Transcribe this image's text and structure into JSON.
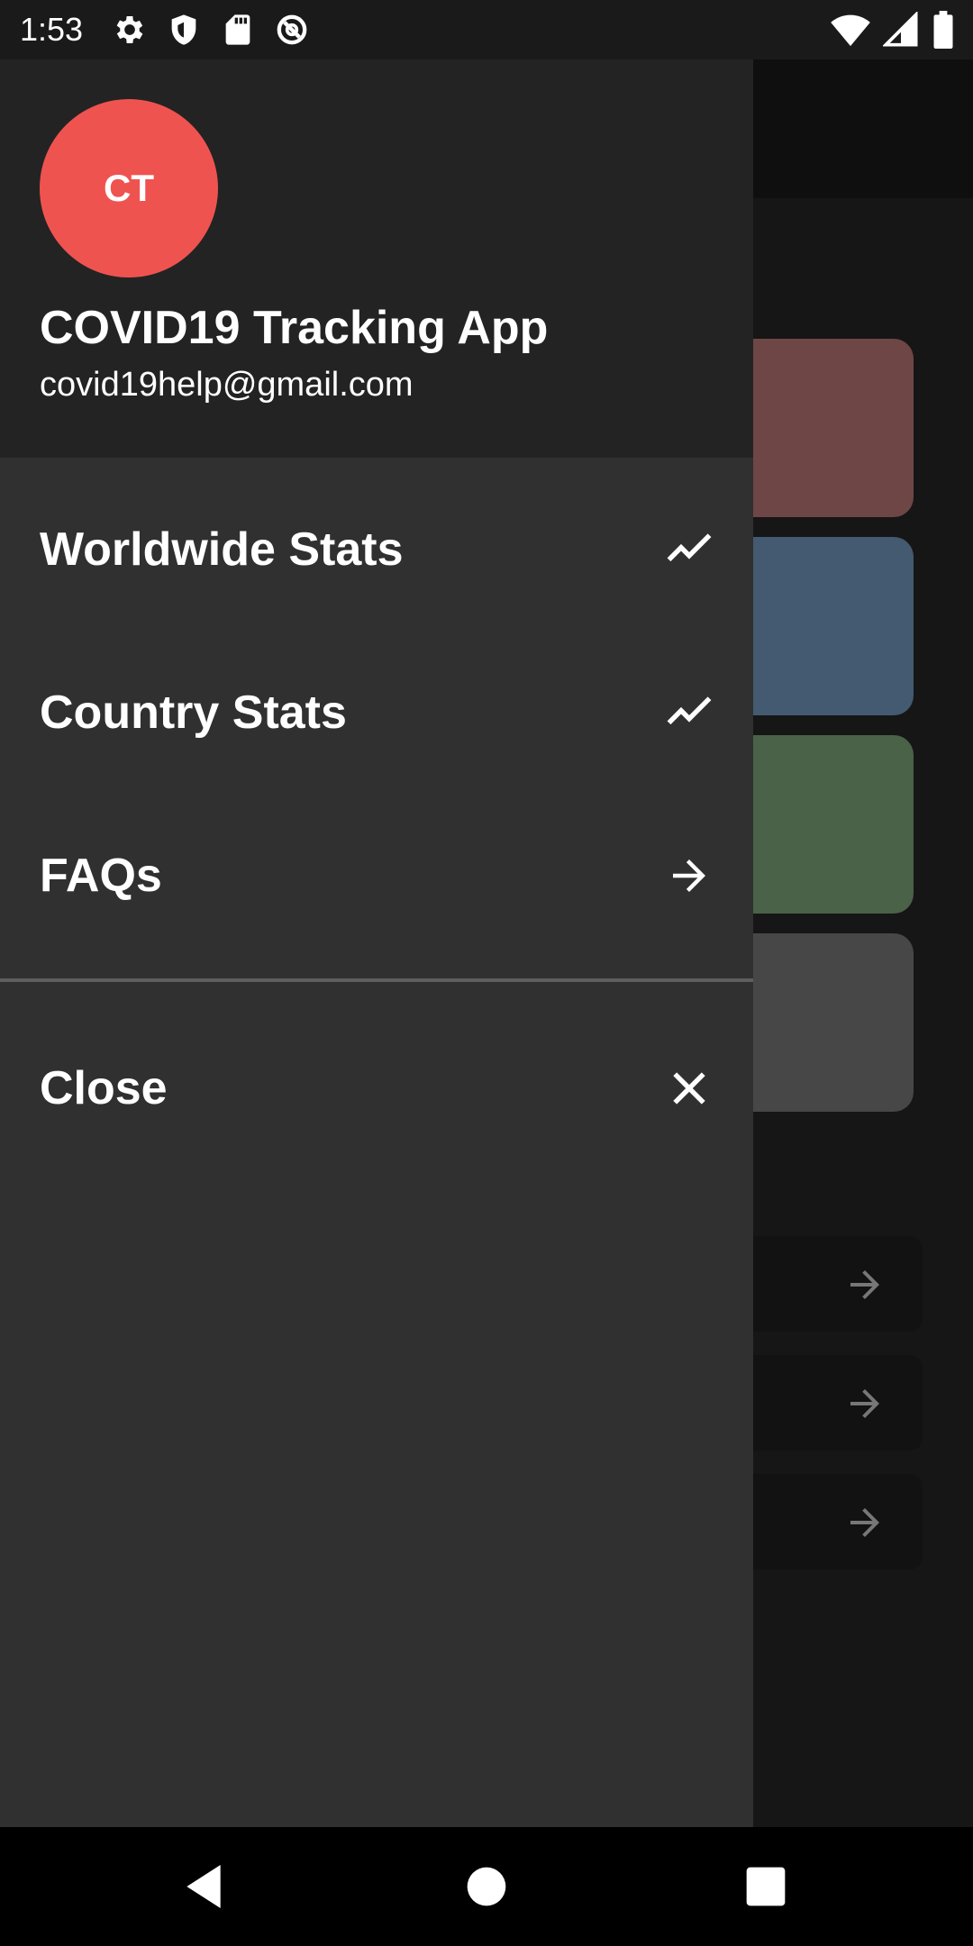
{
  "status_bar": {
    "time": "1:53",
    "left_icons": [
      "settings-gear-icon",
      "shield-icon",
      "sd-card-icon",
      "data-saver-icon"
    ],
    "right_icons": [
      "wifi-icon",
      "signal-icon",
      "battery-icon"
    ]
  },
  "drawer": {
    "avatar_initials": "CT",
    "app_name": "COVID19 Tracking App",
    "email": "covid19help@gmail.com",
    "accent_color": "#ef5350",
    "items": [
      {
        "label": "Worldwide Stats",
        "icon": "trending-up-icon"
      },
      {
        "label": "Country Stats",
        "icon": "trending-up-icon"
      },
      {
        "label": "FAQs",
        "icon": "arrow-forward-icon"
      },
      {
        "label": "Close",
        "icon": "close-icon"
      }
    ]
  },
  "background": {
    "card_colors": [
      "#6e4646",
      "#435a70",
      "#4a6248",
      "#474747"
    ],
    "row_icon": "arrow-forward-icon"
  },
  "nav_bar": {
    "buttons": [
      "back-icon",
      "home-icon",
      "recents-icon"
    ]
  }
}
